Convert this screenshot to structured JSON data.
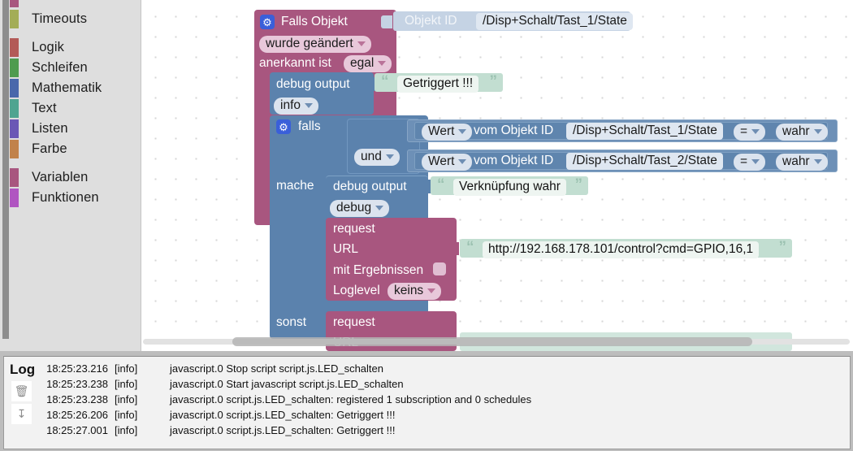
{
  "toolbox": {
    "items": [
      {
        "label": "",
        "color": "#a8567f",
        "partial": true
      },
      {
        "label": "Timeouts",
        "color": "#a3ad57"
      },
      {
        "label": "Logik",
        "color": "#b35a57",
        "gap_before": true
      },
      {
        "label": "Schleifen",
        "color": "#4f9b4f"
      },
      {
        "label": "Mathematik",
        "color": "#4a68ab"
      },
      {
        "label": "Text",
        "color": "#4fa490"
      },
      {
        "label": "Listen",
        "color": "#6a57b5"
      },
      {
        "label": "Farbe",
        "color": "#c1824a"
      },
      {
        "label": "Variablen",
        "color": "#a8567f",
        "gap_before": true
      },
      {
        "label": "Funktionen",
        "color": "#b055c1"
      }
    ]
  },
  "workspace": {
    "event_block": {
      "gear_icon": "gear-icon",
      "title": "Falls Objekt",
      "objekt_id_label": "Objekt ID",
      "objekt_id_value": "/Disp+Schalt/Tast_1/State",
      "trigger_mode": "wurde geändert",
      "ack_label": "anerkannt ist",
      "ack_value": "egal"
    },
    "debug_top": {
      "label": "debug output",
      "level": "info",
      "text": "Getriggert !!!"
    },
    "if_block": {
      "gear_icon": "gear-icon",
      "if_label": "falls",
      "do_label": "mache",
      "else_label": "sonst",
      "operator": "und",
      "conditions": [
        {
          "value_label": "Wert",
          "of_label": "vom Objekt ID",
          "object_id": "/Disp+Schalt/Tast_1/State",
          "comparator": "=",
          "compare_to": "wahr"
        },
        {
          "value_label": "Wert",
          "of_label": "vom Objekt ID",
          "object_id": "/Disp+Schalt/Tast_2/State",
          "comparator": "=",
          "compare_to": "wahr"
        }
      ]
    },
    "debug_do": {
      "label": "debug output",
      "level": "debug",
      "text": "Verknüpfung wahr"
    },
    "request_do": {
      "title": "request",
      "url_label": "URL",
      "url_value": "http://192.168.178.101/control?cmd=GPIO,16,1",
      "results_label": "mit Ergebnissen",
      "results_checked": false,
      "loglevel_label": "Loglevel",
      "loglevel_value": "keins"
    },
    "request_else": {
      "title": "request",
      "url_label": "URL"
    },
    "colors": {
      "event": "#a8567f",
      "logic": "#5b82ad",
      "text": "#c2ded1",
      "object_id": "#c5d3e4"
    }
  },
  "log": {
    "title": "Log",
    "trash_icon": "trash-icon",
    "download_icon": "download-icon",
    "rows": [
      {
        "time": "18:25:23.216",
        "level": "[info]",
        "message": "javascript.0 Stop script script.js.LED_schalten"
      },
      {
        "time": "18:25:23.238",
        "level": "[info]",
        "message": "javascript.0 Start javascript script.js.LED_schalten"
      },
      {
        "time": "18:25:23.238",
        "level": "[info]",
        "message": "javascript.0 script.js.LED_schalten: registered 1 subscription and 0 schedules"
      },
      {
        "time": "18:25:26.206",
        "level": "[info]",
        "message": "javascript.0 script.js.LED_schalten: Getriggert !!!"
      },
      {
        "time": "18:25:27.001",
        "level": "[info]",
        "message": "javascript.0 script.js.LED_schalten: Getriggert !!!"
      }
    ]
  }
}
